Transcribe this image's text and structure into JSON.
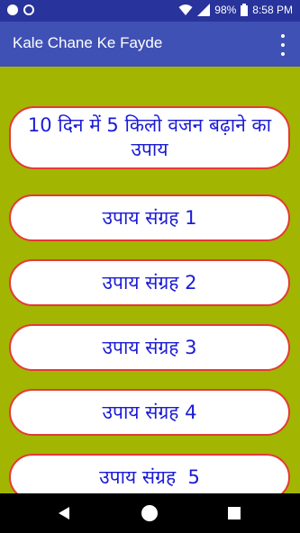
{
  "status_bar": {
    "battery": "98%",
    "time": "8:58 PM",
    "icons": [
      "notification-dot-icon",
      "moon-icon",
      "wifi-icon",
      "signal-icon",
      "battery-icon"
    ]
  },
  "app_bar": {
    "title": "Kale Chane Ke Fayde",
    "menu_icon": "more-vert-icon"
  },
  "buttons": [
    {
      "label": "10 दिन में 5 किलो वजन बढ़ाने का उपाय"
    },
    {
      "label": "उपाय संग्रह 1"
    },
    {
      "label": "उपाय संग्रह 2"
    },
    {
      "label": "उपाय संग्रह 3"
    },
    {
      "label": "उपाय संग्रह 4"
    },
    {
      "label": "उपाय संग्रह  5"
    }
  ],
  "nav_bar": {
    "icons": [
      "back-icon",
      "home-icon",
      "recents-icon"
    ]
  },
  "colors": {
    "status_bar": "#28339b",
    "app_bar": "#3f51b5",
    "background": "#a2b500",
    "button_border": "#e53935",
    "button_text": "#1b1bd6"
  }
}
